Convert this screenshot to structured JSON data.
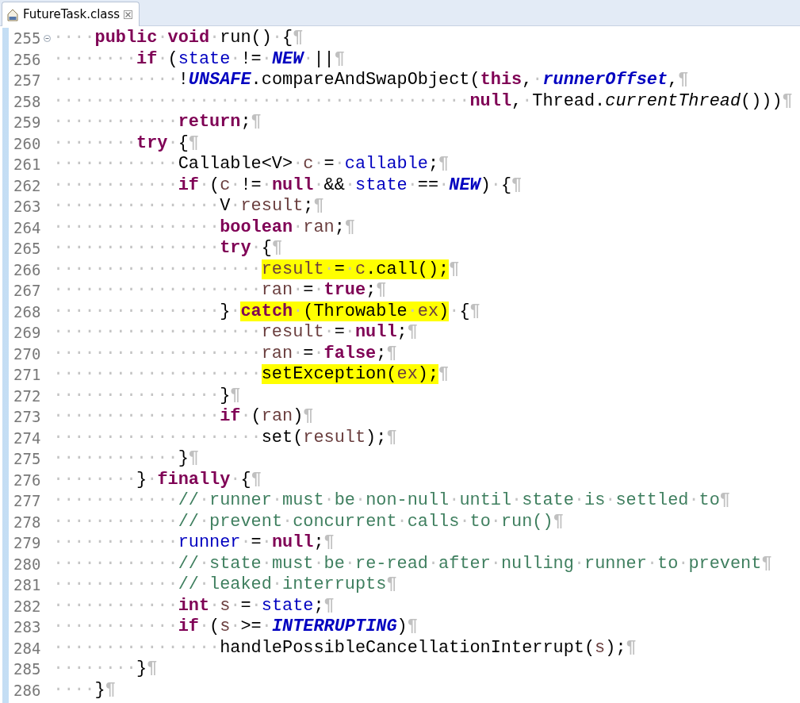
{
  "tab": {
    "title": "FutureTask.class",
    "selected": true
  },
  "lines": [
    {
      "number": "255",
      "fold_marker": true,
      "tokens": [
        {
          "kind": "ws",
          "text": "····"
        },
        {
          "kind": "kw",
          "text": "public"
        },
        {
          "kind": "ws",
          "text": "·"
        },
        {
          "kind": "kw",
          "text": "void"
        },
        {
          "kind": "ws",
          "text": "·"
        },
        {
          "kind": "plain",
          "text": "run()"
        },
        {
          "kind": "ws",
          "text": "·"
        },
        {
          "kind": "plain",
          "text": "{"
        },
        {
          "kind": "eol",
          "text": "¶"
        }
      ]
    },
    {
      "number": "256",
      "tokens": [
        {
          "kind": "ws",
          "text": "········"
        },
        {
          "kind": "kw",
          "text": "if"
        },
        {
          "kind": "ws",
          "text": "·"
        },
        {
          "kind": "plain",
          "text": "("
        },
        {
          "kind": "field",
          "text": "state"
        },
        {
          "kind": "ws",
          "text": "·"
        },
        {
          "kind": "plain",
          "text": "!="
        },
        {
          "kind": "ws",
          "text": "·"
        },
        {
          "kind": "const",
          "text": "NEW"
        },
        {
          "kind": "ws",
          "text": "·"
        },
        {
          "kind": "plain",
          "text": "||"
        },
        {
          "kind": "eol",
          "text": "¶"
        }
      ]
    },
    {
      "number": "257",
      "tokens": [
        {
          "kind": "ws",
          "text": "············"
        },
        {
          "kind": "plain",
          "text": "!"
        },
        {
          "kind": "const",
          "text": "UNSAFE"
        },
        {
          "kind": "plain",
          "text": ".compareAndSwapObject("
        },
        {
          "kind": "kw",
          "text": "this"
        },
        {
          "kind": "plain",
          "text": ","
        },
        {
          "kind": "ws",
          "text": "·"
        },
        {
          "kind": "const",
          "text": "runnerOffset"
        },
        {
          "kind": "plain",
          "text": ","
        },
        {
          "kind": "eol",
          "text": "¶"
        }
      ]
    },
    {
      "number": "258",
      "tokens": [
        {
          "kind": "ws",
          "text": "········································"
        },
        {
          "kind": "kw",
          "text": "null"
        },
        {
          "kind": "plain",
          "text": ","
        },
        {
          "kind": "ws",
          "text": "·"
        },
        {
          "kind": "plain",
          "text": "Thread."
        },
        {
          "kind": "method",
          "text": "currentThread"
        },
        {
          "kind": "plain",
          "text": "()))"
        },
        {
          "kind": "eol",
          "text": "¶"
        }
      ]
    },
    {
      "number": "259",
      "tokens": [
        {
          "kind": "ws",
          "text": "············"
        },
        {
          "kind": "kw",
          "text": "return"
        },
        {
          "kind": "plain",
          "text": ";"
        },
        {
          "kind": "eol",
          "text": "¶"
        }
      ]
    },
    {
      "number": "260",
      "tokens": [
        {
          "kind": "ws",
          "text": "········"
        },
        {
          "kind": "kw",
          "text": "try"
        },
        {
          "kind": "ws",
          "text": "·"
        },
        {
          "kind": "plain",
          "text": "{"
        },
        {
          "kind": "eol",
          "text": "¶"
        }
      ]
    },
    {
      "number": "261",
      "tokens": [
        {
          "kind": "ws",
          "text": "············"
        },
        {
          "kind": "plain",
          "text": "Callable<V>"
        },
        {
          "kind": "ws",
          "text": "·"
        },
        {
          "kind": "local",
          "text": "c"
        },
        {
          "kind": "ws",
          "text": "·"
        },
        {
          "kind": "plain",
          "text": "="
        },
        {
          "kind": "ws",
          "text": "·"
        },
        {
          "kind": "field",
          "text": "callable"
        },
        {
          "kind": "plain",
          "text": ";"
        },
        {
          "kind": "eol",
          "text": "¶"
        }
      ]
    },
    {
      "number": "262",
      "tokens": [
        {
          "kind": "ws",
          "text": "············"
        },
        {
          "kind": "kw",
          "text": "if"
        },
        {
          "kind": "ws",
          "text": "·"
        },
        {
          "kind": "plain",
          "text": "("
        },
        {
          "kind": "local",
          "text": "c"
        },
        {
          "kind": "ws",
          "text": "·"
        },
        {
          "kind": "plain",
          "text": "!="
        },
        {
          "kind": "ws",
          "text": "·"
        },
        {
          "kind": "kw",
          "text": "null"
        },
        {
          "kind": "ws",
          "text": "·"
        },
        {
          "kind": "plain",
          "text": "&&"
        },
        {
          "kind": "ws",
          "text": "·"
        },
        {
          "kind": "field",
          "text": "state"
        },
        {
          "kind": "ws",
          "text": "·"
        },
        {
          "kind": "plain",
          "text": "=="
        },
        {
          "kind": "ws",
          "text": "·"
        },
        {
          "kind": "const",
          "text": "NEW"
        },
        {
          "kind": "plain",
          "text": ")"
        },
        {
          "kind": "ws",
          "text": "·"
        },
        {
          "kind": "plain",
          "text": "{"
        },
        {
          "kind": "eol",
          "text": "¶"
        }
      ]
    },
    {
      "number": "263",
      "tokens": [
        {
          "kind": "ws",
          "text": "················"
        },
        {
          "kind": "plain",
          "text": "V"
        },
        {
          "kind": "ws",
          "text": "·"
        },
        {
          "kind": "local",
          "text": "result"
        },
        {
          "kind": "plain",
          "text": ";"
        },
        {
          "kind": "eol",
          "text": "¶"
        }
      ]
    },
    {
      "number": "264",
      "tokens": [
        {
          "kind": "ws",
          "text": "················"
        },
        {
          "kind": "kw",
          "text": "boolean"
        },
        {
          "kind": "ws",
          "text": "·"
        },
        {
          "kind": "local",
          "text": "ran"
        },
        {
          "kind": "plain",
          "text": ";"
        },
        {
          "kind": "eol",
          "text": "¶"
        }
      ]
    },
    {
      "number": "265",
      "tokens": [
        {
          "kind": "ws",
          "text": "················"
        },
        {
          "kind": "kw",
          "text": "try"
        },
        {
          "kind": "ws",
          "text": "·"
        },
        {
          "kind": "plain",
          "text": "{"
        },
        {
          "kind": "eol",
          "text": "¶"
        }
      ]
    },
    {
      "number": "266",
      "tokens": [
        {
          "kind": "ws",
          "text": "····················"
        },
        {
          "kind": "local",
          "text": "result",
          "highlighted": true
        },
        {
          "kind": "ws",
          "text": "·",
          "highlighted": true
        },
        {
          "kind": "plain",
          "text": "=",
          "highlighted": true
        },
        {
          "kind": "ws",
          "text": "·",
          "highlighted": true
        },
        {
          "kind": "local",
          "text": "c",
          "highlighted": true
        },
        {
          "kind": "plain",
          "text": ".call();",
          "highlighted": true
        },
        {
          "kind": "eol",
          "text": "¶"
        }
      ]
    },
    {
      "number": "267",
      "tokens": [
        {
          "kind": "ws",
          "text": "····················"
        },
        {
          "kind": "local",
          "text": "ran"
        },
        {
          "kind": "ws",
          "text": "·"
        },
        {
          "kind": "plain",
          "text": "="
        },
        {
          "kind": "ws",
          "text": "·"
        },
        {
          "kind": "kw",
          "text": "true"
        },
        {
          "kind": "plain",
          "text": ";"
        },
        {
          "kind": "eol",
          "text": "¶"
        }
      ]
    },
    {
      "number": "268",
      "tokens": [
        {
          "kind": "ws",
          "text": "················"
        },
        {
          "kind": "plain",
          "text": "}"
        },
        {
          "kind": "ws",
          "text": "·"
        },
        {
          "kind": "kw",
          "text": "catch",
          "highlighted": true
        },
        {
          "kind": "ws",
          "text": "·",
          "highlighted": true
        },
        {
          "kind": "plain",
          "text": "(Throwable",
          "highlighted": true
        },
        {
          "kind": "ws",
          "text": "·",
          "highlighted": true
        },
        {
          "kind": "local",
          "text": "ex",
          "highlighted": true
        },
        {
          "kind": "plain",
          "text": ")",
          "highlighted": true
        },
        {
          "kind": "ws",
          "text": "·"
        },
        {
          "kind": "plain",
          "text": "{"
        },
        {
          "kind": "eol",
          "text": "¶"
        }
      ]
    },
    {
      "number": "269",
      "tokens": [
        {
          "kind": "ws",
          "text": "····················"
        },
        {
          "kind": "local",
          "text": "result"
        },
        {
          "kind": "ws",
          "text": "·"
        },
        {
          "kind": "plain",
          "text": "="
        },
        {
          "kind": "ws",
          "text": "·"
        },
        {
          "kind": "kw",
          "text": "null"
        },
        {
          "kind": "plain",
          "text": ";"
        },
        {
          "kind": "eol",
          "text": "¶"
        }
      ]
    },
    {
      "number": "270",
      "tokens": [
        {
          "kind": "ws",
          "text": "····················"
        },
        {
          "kind": "local",
          "text": "ran"
        },
        {
          "kind": "ws",
          "text": "·"
        },
        {
          "kind": "plain",
          "text": "="
        },
        {
          "kind": "ws",
          "text": "·"
        },
        {
          "kind": "kw",
          "text": "false"
        },
        {
          "kind": "plain",
          "text": ";"
        },
        {
          "kind": "eol",
          "text": "¶"
        }
      ]
    },
    {
      "number": "271",
      "tokens": [
        {
          "kind": "ws",
          "text": "····················"
        },
        {
          "kind": "plain",
          "text": "setException(",
          "highlighted": true
        },
        {
          "kind": "local",
          "text": "ex",
          "highlighted": true
        },
        {
          "kind": "plain",
          "text": ");",
          "highlighted": true
        },
        {
          "kind": "eol",
          "text": "¶"
        }
      ]
    },
    {
      "number": "272",
      "tokens": [
        {
          "kind": "ws",
          "text": "················"
        },
        {
          "kind": "plain",
          "text": "}"
        },
        {
          "kind": "eol",
          "text": "¶"
        }
      ]
    },
    {
      "number": "273",
      "tokens": [
        {
          "kind": "ws",
          "text": "················"
        },
        {
          "kind": "kw",
          "text": "if"
        },
        {
          "kind": "ws",
          "text": "·"
        },
        {
          "kind": "plain",
          "text": "("
        },
        {
          "kind": "local",
          "text": "ran"
        },
        {
          "kind": "plain",
          "text": ")"
        },
        {
          "kind": "eol",
          "text": "¶"
        }
      ]
    },
    {
      "number": "274",
      "tokens": [
        {
          "kind": "ws",
          "text": "····················"
        },
        {
          "kind": "plain",
          "text": "set("
        },
        {
          "kind": "local",
          "text": "result"
        },
        {
          "kind": "plain",
          "text": ");"
        },
        {
          "kind": "eol",
          "text": "¶"
        }
      ]
    },
    {
      "number": "275",
      "tokens": [
        {
          "kind": "ws",
          "text": "············"
        },
        {
          "kind": "plain",
          "text": "}"
        },
        {
          "kind": "eol",
          "text": "¶"
        }
      ]
    },
    {
      "number": "276",
      "tokens": [
        {
          "kind": "ws",
          "text": "········"
        },
        {
          "kind": "plain",
          "text": "}"
        },
        {
          "kind": "ws",
          "text": "·"
        },
        {
          "kind": "kw",
          "text": "finally"
        },
        {
          "kind": "ws",
          "text": "·"
        },
        {
          "kind": "plain",
          "text": "{"
        },
        {
          "kind": "eol",
          "text": "¶"
        }
      ]
    },
    {
      "number": "277",
      "tokens": [
        {
          "kind": "ws",
          "text": "············"
        },
        {
          "kind": "comment",
          "text": "//"
        },
        {
          "kind": "ws",
          "text": "·"
        },
        {
          "kind": "comment",
          "text": "runner"
        },
        {
          "kind": "ws",
          "text": "·"
        },
        {
          "kind": "comment",
          "text": "must"
        },
        {
          "kind": "ws",
          "text": "·"
        },
        {
          "kind": "comment",
          "text": "be"
        },
        {
          "kind": "ws",
          "text": "·"
        },
        {
          "kind": "comment",
          "text": "non-null"
        },
        {
          "kind": "ws",
          "text": "·"
        },
        {
          "kind": "comment",
          "text": "until"
        },
        {
          "kind": "ws",
          "text": "·"
        },
        {
          "kind": "comment",
          "text": "state"
        },
        {
          "kind": "ws",
          "text": "·"
        },
        {
          "kind": "comment",
          "text": "is"
        },
        {
          "kind": "ws",
          "text": "·"
        },
        {
          "kind": "comment",
          "text": "settled"
        },
        {
          "kind": "ws",
          "text": "·"
        },
        {
          "kind": "comment",
          "text": "to"
        },
        {
          "kind": "eol",
          "text": "¶"
        }
      ]
    },
    {
      "number": "278",
      "tokens": [
        {
          "kind": "ws",
          "text": "············"
        },
        {
          "kind": "comment",
          "text": "//"
        },
        {
          "kind": "ws",
          "text": "·"
        },
        {
          "kind": "comment",
          "text": "prevent"
        },
        {
          "kind": "ws",
          "text": "·"
        },
        {
          "kind": "comment",
          "text": "concurrent"
        },
        {
          "kind": "ws",
          "text": "·"
        },
        {
          "kind": "comment",
          "text": "calls"
        },
        {
          "kind": "ws",
          "text": "·"
        },
        {
          "kind": "comment",
          "text": "to"
        },
        {
          "kind": "ws",
          "text": "·"
        },
        {
          "kind": "comment",
          "text": "run()"
        },
        {
          "kind": "eol",
          "text": "¶"
        }
      ]
    },
    {
      "number": "279",
      "tokens": [
        {
          "kind": "ws",
          "text": "············"
        },
        {
          "kind": "field",
          "text": "runner"
        },
        {
          "kind": "ws",
          "text": "·"
        },
        {
          "kind": "plain",
          "text": "="
        },
        {
          "kind": "ws",
          "text": "·"
        },
        {
          "kind": "kw",
          "text": "null"
        },
        {
          "kind": "plain",
          "text": ";"
        },
        {
          "kind": "eol",
          "text": "¶"
        }
      ]
    },
    {
      "number": "280",
      "tokens": [
        {
          "kind": "ws",
          "text": "············"
        },
        {
          "kind": "comment",
          "text": "//"
        },
        {
          "kind": "ws",
          "text": "·"
        },
        {
          "kind": "comment",
          "text": "state"
        },
        {
          "kind": "ws",
          "text": "·"
        },
        {
          "kind": "comment",
          "text": "must"
        },
        {
          "kind": "ws",
          "text": "·"
        },
        {
          "kind": "comment",
          "text": "be"
        },
        {
          "kind": "ws",
          "text": "·"
        },
        {
          "kind": "comment",
          "text": "re-read"
        },
        {
          "kind": "ws",
          "text": "·"
        },
        {
          "kind": "comment",
          "text": "after"
        },
        {
          "kind": "ws",
          "text": "·"
        },
        {
          "kind": "comment",
          "text": "nulling"
        },
        {
          "kind": "ws",
          "text": "·"
        },
        {
          "kind": "comment",
          "text": "runner"
        },
        {
          "kind": "ws",
          "text": "·"
        },
        {
          "kind": "comment",
          "text": "to"
        },
        {
          "kind": "ws",
          "text": "·"
        },
        {
          "kind": "comment",
          "text": "prevent"
        },
        {
          "kind": "eol",
          "text": "¶"
        }
      ]
    },
    {
      "number": "281",
      "tokens": [
        {
          "kind": "ws",
          "text": "············"
        },
        {
          "kind": "comment",
          "text": "//"
        },
        {
          "kind": "ws",
          "text": "·"
        },
        {
          "kind": "comment",
          "text": "leaked"
        },
        {
          "kind": "ws",
          "text": "·"
        },
        {
          "kind": "comment",
          "text": "interrupts"
        },
        {
          "kind": "eol",
          "text": "¶"
        }
      ]
    },
    {
      "number": "282",
      "tokens": [
        {
          "kind": "ws",
          "text": "············"
        },
        {
          "kind": "kw",
          "text": "int"
        },
        {
          "kind": "ws",
          "text": "·"
        },
        {
          "kind": "local",
          "text": "s"
        },
        {
          "kind": "ws",
          "text": "·"
        },
        {
          "kind": "plain",
          "text": "="
        },
        {
          "kind": "ws",
          "text": "·"
        },
        {
          "kind": "field",
          "text": "state"
        },
        {
          "kind": "plain",
          "text": ";"
        },
        {
          "kind": "eol",
          "text": "¶"
        }
      ]
    },
    {
      "number": "283",
      "tokens": [
        {
          "kind": "ws",
          "text": "············"
        },
        {
          "kind": "kw",
          "text": "if"
        },
        {
          "kind": "ws",
          "text": "·"
        },
        {
          "kind": "plain",
          "text": "("
        },
        {
          "kind": "local",
          "text": "s"
        },
        {
          "kind": "ws",
          "text": "·"
        },
        {
          "kind": "plain",
          "text": ">="
        },
        {
          "kind": "ws",
          "text": "·"
        },
        {
          "kind": "const",
          "text": "INTERRUPTING"
        },
        {
          "kind": "plain",
          "text": ")"
        },
        {
          "kind": "eol",
          "text": "¶"
        }
      ]
    },
    {
      "number": "284",
      "tokens": [
        {
          "kind": "ws",
          "text": "················"
        },
        {
          "kind": "plain",
          "text": "handlePossibleCancellationInterrupt("
        },
        {
          "kind": "local",
          "text": "s"
        },
        {
          "kind": "plain",
          "text": ");"
        },
        {
          "kind": "eol",
          "text": "¶"
        }
      ]
    },
    {
      "number": "285",
      "tokens": [
        {
          "kind": "ws",
          "text": "········"
        },
        {
          "kind": "plain",
          "text": "}"
        },
        {
          "kind": "eol",
          "text": "¶"
        }
      ]
    },
    {
      "number": "286",
      "tokens": [
        {
          "kind": "ws",
          "text": "····"
        },
        {
          "kind": "plain",
          "text": "}"
        },
        {
          "kind": "eol",
          "text": "¶"
        }
      ]
    }
  ]
}
